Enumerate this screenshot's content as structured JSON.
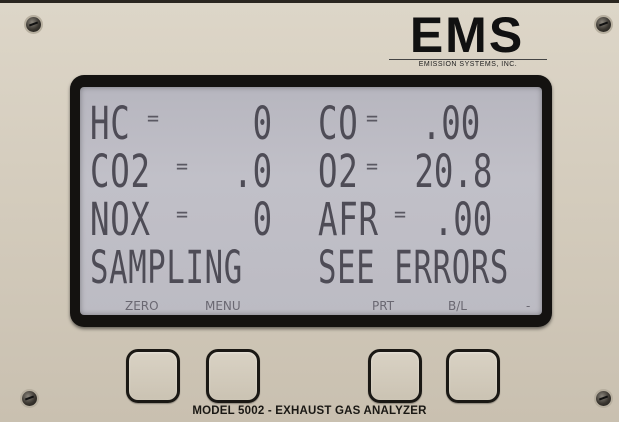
{
  "brand": {
    "logo": "EMS",
    "subtitle": "EMISSION SYSTEMS, INC."
  },
  "display": {
    "rows": [
      {
        "left_label": "HC",
        "left_value": "0",
        "right_label": "CO",
        "right_value": ".00"
      },
      {
        "left_label": "CO2",
        "left_value": ".0",
        "right_label": "O2",
        "right_value": "20.8"
      },
      {
        "left_label": "NOX",
        "left_value": "0",
        "right_label": "AFR",
        "right_value": ".00"
      }
    ],
    "eq_sign": "=",
    "status_left": "SAMPLING",
    "status_right": "SEE ERRORS",
    "softkeys": [
      "ZERO",
      "MENU",
      "PRT",
      "B/L",
      "-"
    ]
  },
  "model_label": "MODEL 5002 - EXHAUST GAS ANALYZER",
  "colors": {
    "lcd_background": "#bcbbc3",
    "lcd_text": "#4e4c56",
    "panel": "#d4ccbd",
    "bezel": "#141210"
  }
}
